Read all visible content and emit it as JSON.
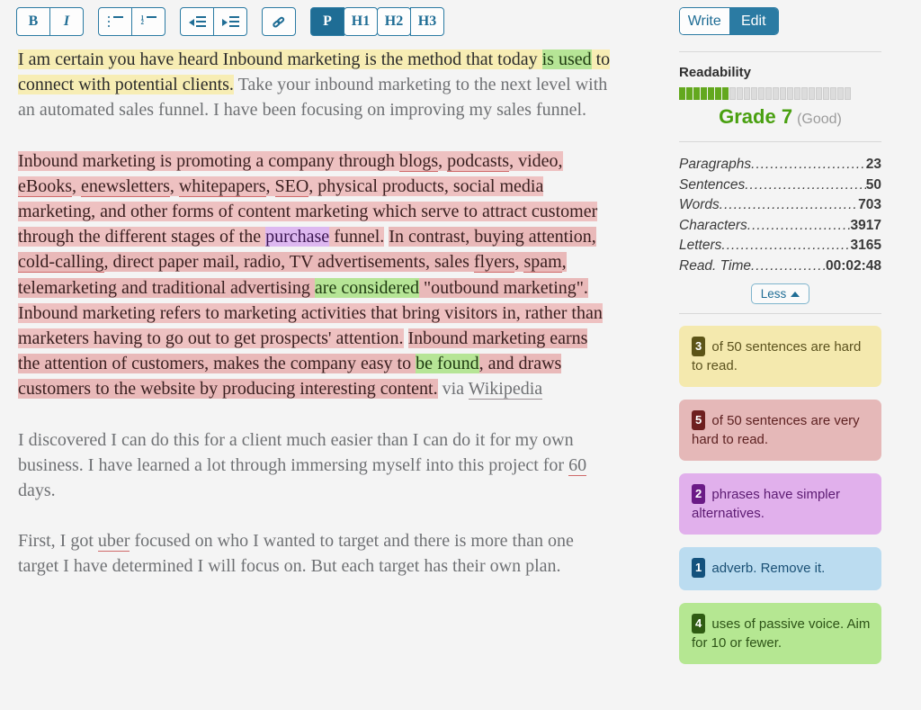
{
  "toolbar": {
    "groups": [
      {
        "name": "format",
        "buttons": [
          {
            "id": "bold",
            "label": "B",
            "icon": "bold-icon",
            "active": false
          },
          {
            "id": "italic",
            "label": "I",
            "icon": "italic-icon",
            "active": false
          }
        ]
      },
      {
        "name": "lists",
        "buttons": [
          {
            "id": "bullet-list",
            "label": "",
            "icon": "bullet-list-icon",
            "active": false
          },
          {
            "id": "numbered-list",
            "label": "",
            "icon": "numbered-list-icon",
            "active": false
          }
        ]
      },
      {
        "name": "indent",
        "buttons": [
          {
            "id": "outdent",
            "label": "",
            "icon": "outdent-icon",
            "active": false
          },
          {
            "id": "indent",
            "label": "",
            "icon": "indent-icon",
            "active": false
          }
        ]
      },
      {
        "name": "link",
        "buttons": [
          {
            "id": "link",
            "label": "",
            "icon": "link-icon",
            "active": false
          }
        ]
      },
      {
        "name": "blocks",
        "buttons": [
          {
            "id": "paragraph",
            "label": "P",
            "icon": "paragraph-icon",
            "active": true
          },
          {
            "id": "h1",
            "label": "H1",
            "icon": "heading-1-icon",
            "active": false
          },
          {
            "id": "h2",
            "label": "H2",
            "icon": "heading-2-icon",
            "active": false
          },
          {
            "id": "h3",
            "label": "H3",
            "icon": "heading-3-icon",
            "active": false
          }
        ]
      }
    ]
  },
  "mode": {
    "write_label": "Write",
    "edit_label": "Edit",
    "active": "Edit"
  },
  "readability": {
    "title": "Readability",
    "bars_total": 24,
    "bars_filled": 7,
    "grade": "Grade 7",
    "quality": "(Good)",
    "grade_color": "#49a010"
  },
  "stats": {
    "rows": [
      {
        "label": "Paragraphs",
        "value": "23"
      },
      {
        "label": "Sentences",
        "value": "50"
      },
      {
        "label": "Words",
        "value": "703"
      },
      {
        "label": "Characters",
        "value": "3917"
      },
      {
        "label": "Letters",
        "value": "3165"
      },
      {
        "label": "Read. Time",
        "value": "00:02:48"
      }
    ]
  },
  "less_button": {
    "label": "Less",
    "icon": "caret-up-icon"
  },
  "cards": [
    {
      "id": "hard-to-read",
      "color": "yellow",
      "count": "3",
      "text": " of 50 sentences are hard to read."
    },
    {
      "id": "very-hard-to-read",
      "color": "red",
      "count": "5",
      "text": " of 50 sentences are very hard to read."
    },
    {
      "id": "simpler-alternatives",
      "color": "purple",
      "count": "2",
      "text": " phrases have simpler alternatives."
    },
    {
      "id": "adverbs",
      "color": "blue",
      "count": "1",
      "text": " adverb. Remove it."
    },
    {
      "id": "passive-voice",
      "color": "green",
      "count": "4",
      "text": " uses of passive voice. Aim for 10 or fewer."
    }
  ],
  "document": {
    "paragraphs": [
      {
        "id": "p1",
        "runs": [
          {
            "t": "I am certain you have heard Inbound marketing is the method that today ",
            "s": "hl-hard"
          },
          {
            "t": "is used",
            "s": "hl-passive"
          },
          {
            "t": " to connect with potential clients.",
            "s": "hl-hard"
          },
          {
            "t": " Take your inbound marketing to the next level with an automated sales funnel. I have been focusing on improving my sales funnel.",
            "s": ""
          }
        ]
      },
      {
        "id": "p2",
        "runs": [
          {
            "t": "Inbound marketing is promoting a company through ",
            "s": "hl-vhard"
          },
          {
            "t": "blogs",
            "s": "hl-vhard sp"
          },
          {
            "t": ", ",
            "s": "hl-vhard"
          },
          {
            "t": "podcasts",
            "s": "hl-vhard sp"
          },
          {
            "t": ", video, ",
            "s": "hl-vhard"
          },
          {
            "t": "eBooks",
            "s": "hl-vhard sp"
          },
          {
            "t": ", ",
            "s": "hl-vhard"
          },
          {
            "t": "enewsletters",
            "s": "hl-vhard sp"
          },
          {
            "t": ", ",
            "s": "hl-vhard"
          },
          {
            "t": "whitepapers",
            "s": "hl-vhard sp"
          },
          {
            "t": ", ",
            "s": "hl-vhard"
          },
          {
            "t": "SEO",
            "s": "hl-vhard sp"
          },
          {
            "t": ", physical products, social media marketing, and other forms of content marketing which serve to attract customer through the different stages of the ",
            "s": "hl-vhard"
          },
          {
            "t": "purchase",
            "s": "hl-simpler"
          },
          {
            "t": " funnel.",
            "s": "hl-vhard"
          },
          {
            "t": " ",
            "s": ""
          },
          {
            "t": "In contrast, buying attention, ",
            "s": "hl-vhard2"
          },
          {
            "t": "cold-calling",
            "s": "hl-vhard2 sp"
          },
          {
            "t": ", direct paper mail, radio, TV advertisements, sales ",
            "s": "hl-vhard2"
          },
          {
            "t": "flyers",
            "s": "hl-vhard2 sp"
          },
          {
            "t": ", ",
            "s": "hl-vhard2"
          },
          {
            "t": "spam",
            "s": "hl-vhard2 sp"
          },
          {
            "t": ", telemarketing and traditional advertising ",
            "s": "hl-vhard2"
          },
          {
            "t": "are considered",
            "s": "hl-passive"
          },
          {
            "t": " \"outbound marketing\".",
            "s": "hl-vhard2"
          },
          {
            "t": " ",
            "s": ""
          },
          {
            "t": "Inbound marketing refers to marketing activities that bring visitors in, rather than marketers having to go out to get prospects' attention.",
            "s": "hl-vhard"
          },
          {
            "t": " ",
            "s": ""
          },
          {
            "t": "Inbound marketing earns the attention of customers, makes the company easy to ",
            "s": "hl-vhard2"
          },
          {
            "t": "be found",
            "s": "hl-passive"
          },
          {
            "t": ", and draws customers to the website by producing interesting content.",
            "s": "hl-vhard2"
          },
          {
            "t": " via ",
            "s": ""
          },
          {
            "t": "Wikipedia",
            "s": "sp-gray"
          }
        ]
      },
      {
        "id": "p3",
        "runs": [
          {
            "t": "I discovered I can do this for a client much easier than I can do it for my own business. I have learned a lot through immersing myself into this project for ",
            "s": ""
          },
          {
            "t": "60",
            "s": "sp"
          },
          {
            "t": " days.",
            "s": ""
          }
        ]
      },
      {
        "id": "p4",
        "runs": [
          {
            "t": "First, I got ",
            "s": ""
          },
          {
            "t": "uber",
            "s": "sp"
          },
          {
            "t": " focused on who I wanted to target and there is more than one target I have determined I will focus on. But each target has their own plan.",
            "s": ""
          }
        ]
      }
    ]
  }
}
